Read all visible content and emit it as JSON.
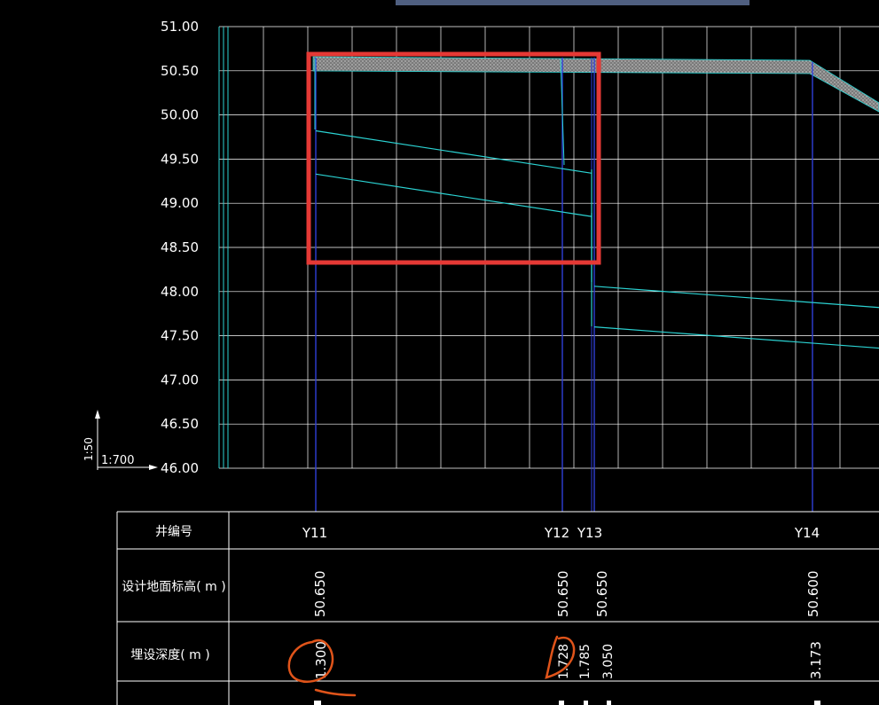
{
  "profile": {
    "y_axis": {
      "ticks": [
        "51.00",
        "50.50",
        "50.00",
        "49.50",
        "49.00",
        "48.50",
        "48.00",
        "47.50",
        "47.00",
        "46.50",
        "46.00"
      ],
      "min": 46.0,
      "max": 51.0,
      "step": 0.5
    },
    "scale": {
      "vertical": "1:50",
      "horizontal": "1:700"
    },
    "wells": [
      {
        "id": "Y11",
        "ground": 50.65
      },
      {
        "id": "Y12",
        "ground": 50.65
      },
      {
        "id": "Y13",
        "ground": 50.65
      },
      {
        "id": "Y14",
        "ground": 50.6
      }
    ],
    "pipe_upper_segments": [
      {
        "from": "Y11",
        "to": "Y13",
        "start": 49.82,
        "end": 49.34
      },
      {
        "from": "Y13",
        "to": "edge",
        "start": 48.06,
        "end": 47.82
      }
    ],
    "pipe_lower_segments": [
      {
        "from": "Y11",
        "to": "Y13",
        "start": 49.33,
        "end": 48.85
      },
      {
        "from": "Y13",
        "to": "edge",
        "start": 47.6,
        "end": 47.36
      }
    ],
    "highlight_box": {
      "label": "",
      "color": "#e53935"
    },
    "colors": {
      "grid": "#ffffff",
      "pipe": "#2bd3d3",
      "well_line": "#2f3fd8",
      "annotation": "#e0541a"
    }
  },
  "table": {
    "rows": [
      {
        "key": "well_number",
        "label": "井编号",
        "values": {
          "Y11": "Y11",
          "Y12": "Y12",
          "Y13": "Y13",
          "Y14": "Y14"
        }
      },
      {
        "key": "ground_elevation",
        "label": "设计地面标高(    m  )",
        "values": {
          "Y11": "50.650",
          "Y12": "50.650",
          "Y13": "50.650",
          "Y14": "50.600"
        }
      },
      {
        "key": "burial_depth",
        "label": "埋设深度(    m  )",
        "values": {
          "Y11": "1.300",
          "Y12": "1.728",
          "Y12b": "1.785",
          "Y13": "3.050",
          "Y14": "3.173"
        }
      }
    ]
  }
}
